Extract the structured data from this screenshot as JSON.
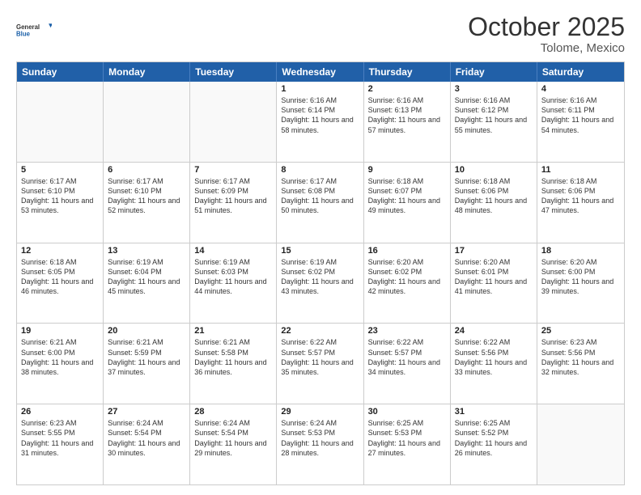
{
  "header": {
    "title": "October 2025",
    "location": "Tolome, Mexico",
    "logo_general": "General",
    "logo_blue": "Blue"
  },
  "days_of_week": [
    "Sunday",
    "Monday",
    "Tuesday",
    "Wednesday",
    "Thursday",
    "Friday",
    "Saturday"
  ],
  "weeks": [
    [
      {
        "day": "",
        "empty": true
      },
      {
        "day": "",
        "empty": true
      },
      {
        "day": "",
        "empty": true
      },
      {
        "day": "1",
        "sunrise": "Sunrise: 6:16 AM",
        "sunset": "Sunset: 6:14 PM",
        "daylight": "Daylight: 11 hours and 58 minutes."
      },
      {
        "day": "2",
        "sunrise": "Sunrise: 6:16 AM",
        "sunset": "Sunset: 6:13 PM",
        "daylight": "Daylight: 11 hours and 57 minutes."
      },
      {
        "day": "3",
        "sunrise": "Sunrise: 6:16 AM",
        "sunset": "Sunset: 6:12 PM",
        "daylight": "Daylight: 11 hours and 55 minutes."
      },
      {
        "day": "4",
        "sunrise": "Sunrise: 6:16 AM",
        "sunset": "Sunset: 6:11 PM",
        "daylight": "Daylight: 11 hours and 54 minutes."
      }
    ],
    [
      {
        "day": "5",
        "sunrise": "Sunrise: 6:17 AM",
        "sunset": "Sunset: 6:10 PM",
        "daylight": "Daylight: 11 hours and 53 minutes."
      },
      {
        "day": "6",
        "sunrise": "Sunrise: 6:17 AM",
        "sunset": "Sunset: 6:10 PM",
        "daylight": "Daylight: 11 hours and 52 minutes."
      },
      {
        "day": "7",
        "sunrise": "Sunrise: 6:17 AM",
        "sunset": "Sunset: 6:09 PM",
        "daylight": "Daylight: 11 hours and 51 minutes."
      },
      {
        "day": "8",
        "sunrise": "Sunrise: 6:17 AM",
        "sunset": "Sunset: 6:08 PM",
        "daylight": "Daylight: 11 hours and 50 minutes."
      },
      {
        "day": "9",
        "sunrise": "Sunrise: 6:18 AM",
        "sunset": "Sunset: 6:07 PM",
        "daylight": "Daylight: 11 hours and 49 minutes."
      },
      {
        "day": "10",
        "sunrise": "Sunrise: 6:18 AM",
        "sunset": "Sunset: 6:06 PM",
        "daylight": "Daylight: 11 hours and 48 minutes."
      },
      {
        "day": "11",
        "sunrise": "Sunrise: 6:18 AM",
        "sunset": "Sunset: 6:06 PM",
        "daylight": "Daylight: 11 hours and 47 minutes."
      }
    ],
    [
      {
        "day": "12",
        "sunrise": "Sunrise: 6:18 AM",
        "sunset": "Sunset: 6:05 PM",
        "daylight": "Daylight: 11 hours and 46 minutes."
      },
      {
        "day": "13",
        "sunrise": "Sunrise: 6:19 AM",
        "sunset": "Sunset: 6:04 PM",
        "daylight": "Daylight: 11 hours and 45 minutes."
      },
      {
        "day": "14",
        "sunrise": "Sunrise: 6:19 AM",
        "sunset": "Sunset: 6:03 PM",
        "daylight": "Daylight: 11 hours and 44 minutes."
      },
      {
        "day": "15",
        "sunrise": "Sunrise: 6:19 AM",
        "sunset": "Sunset: 6:02 PM",
        "daylight": "Daylight: 11 hours and 43 minutes."
      },
      {
        "day": "16",
        "sunrise": "Sunrise: 6:20 AM",
        "sunset": "Sunset: 6:02 PM",
        "daylight": "Daylight: 11 hours and 42 minutes."
      },
      {
        "day": "17",
        "sunrise": "Sunrise: 6:20 AM",
        "sunset": "Sunset: 6:01 PM",
        "daylight": "Daylight: 11 hours and 41 minutes."
      },
      {
        "day": "18",
        "sunrise": "Sunrise: 6:20 AM",
        "sunset": "Sunset: 6:00 PM",
        "daylight": "Daylight: 11 hours and 39 minutes."
      }
    ],
    [
      {
        "day": "19",
        "sunrise": "Sunrise: 6:21 AM",
        "sunset": "Sunset: 6:00 PM",
        "daylight": "Daylight: 11 hours and 38 minutes."
      },
      {
        "day": "20",
        "sunrise": "Sunrise: 6:21 AM",
        "sunset": "Sunset: 5:59 PM",
        "daylight": "Daylight: 11 hours and 37 minutes."
      },
      {
        "day": "21",
        "sunrise": "Sunrise: 6:21 AM",
        "sunset": "Sunset: 5:58 PM",
        "daylight": "Daylight: 11 hours and 36 minutes."
      },
      {
        "day": "22",
        "sunrise": "Sunrise: 6:22 AM",
        "sunset": "Sunset: 5:57 PM",
        "daylight": "Daylight: 11 hours and 35 minutes."
      },
      {
        "day": "23",
        "sunrise": "Sunrise: 6:22 AM",
        "sunset": "Sunset: 5:57 PM",
        "daylight": "Daylight: 11 hours and 34 minutes."
      },
      {
        "day": "24",
        "sunrise": "Sunrise: 6:22 AM",
        "sunset": "Sunset: 5:56 PM",
        "daylight": "Daylight: 11 hours and 33 minutes."
      },
      {
        "day": "25",
        "sunrise": "Sunrise: 6:23 AM",
        "sunset": "Sunset: 5:56 PM",
        "daylight": "Daylight: 11 hours and 32 minutes."
      }
    ],
    [
      {
        "day": "26",
        "sunrise": "Sunrise: 6:23 AM",
        "sunset": "Sunset: 5:55 PM",
        "daylight": "Daylight: 11 hours and 31 minutes."
      },
      {
        "day": "27",
        "sunrise": "Sunrise: 6:24 AM",
        "sunset": "Sunset: 5:54 PM",
        "daylight": "Daylight: 11 hours and 30 minutes."
      },
      {
        "day": "28",
        "sunrise": "Sunrise: 6:24 AM",
        "sunset": "Sunset: 5:54 PM",
        "daylight": "Daylight: 11 hours and 29 minutes."
      },
      {
        "day": "29",
        "sunrise": "Sunrise: 6:24 AM",
        "sunset": "Sunset: 5:53 PM",
        "daylight": "Daylight: 11 hours and 28 minutes."
      },
      {
        "day": "30",
        "sunrise": "Sunrise: 6:25 AM",
        "sunset": "Sunset: 5:53 PM",
        "daylight": "Daylight: 11 hours and 27 minutes."
      },
      {
        "day": "31",
        "sunrise": "Sunrise: 6:25 AM",
        "sunset": "Sunset: 5:52 PM",
        "daylight": "Daylight: 11 hours and 26 minutes."
      },
      {
        "day": "",
        "empty": true
      }
    ]
  ]
}
